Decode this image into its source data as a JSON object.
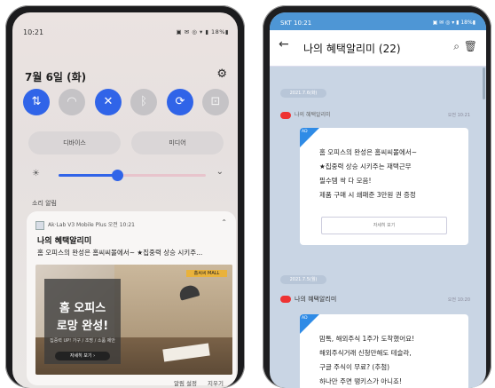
{
  "left_phone": {
    "status": {
      "time": "10:21",
      "indicators": "▣ ✉ ◎ ▾ ▮ 18%▮"
    },
    "date": "7월 6일 (화)",
    "quick_settings": [
      {
        "icon": "data-transfer-icon",
        "glyph": "⇅",
        "on": true
      },
      {
        "icon": "wifi-icon",
        "glyph": "◠",
        "on": false
      },
      {
        "icon": "sound-mute-icon",
        "glyph": "🔇",
        "on": true
      },
      {
        "icon": "bluetooth-icon",
        "glyph": "ᛒ",
        "on": false
      },
      {
        "icon": "auto-rotate-icon",
        "glyph": "⟳",
        "on": true
      },
      {
        "icon": "flashlight-icon",
        "glyph": "⊡",
        "on": false
      }
    ],
    "pills": {
      "device": "디바이스",
      "media": "미디어"
    },
    "brightness_level": 0.4,
    "section_label": "소리 알림",
    "notification": {
      "header": "Ak·Lab V3 Mobile Plus  오전 10:21",
      "title": "나의 혜택알리미",
      "body": "홈 오피스의 완성은 홈씨씨몰에서~ ★집중력 상승 시키주...",
      "image": {
        "logo": "홈씨씨 MALL",
        "headline1": "홈 오피스",
        "headline2": "로망 완성!",
        "sub": "집중력 UP! 가구 / 조명 / 소품 제안",
        "cta": "자세히 보기 ›"
      }
    },
    "footer": {
      "settings": "알림 설정",
      "clear": "지우기"
    }
  },
  "right_phone": {
    "status": {
      "carrier": "SKT 10:21",
      "indicators": "▣ ✉ ◎ ▾ ▮ 18%▮"
    },
    "appbar": {
      "title": "나의 혜택알리미 (22)"
    },
    "messages": [
      {
        "date": "2021.7.6(화)",
        "sender": "나의 혜택알리미",
        "time": "오전 10:21",
        "ribbon": "AD",
        "lines": [
          "홈 오피스의 완성은 홈씨씨몰에서~",
          "★집중력 상승 시키주는 재택근무",
          "필수템 싹 다 모음!",
          "제품 구매 시 쇄패준 3만원 권 증정"
        ],
        "button": "자세히 보기"
      },
      {
        "date": "2021.7.5(월)",
        "sender": "나의 혜택알리미",
        "time": "오전 10:20",
        "ribbon": "AD",
        "lines": [
          "맘톡, 해외주식 1주가 도착했어요!",
          "해외주식거래 신청만해도 테슬라,",
          "구글 주식이 무료? (추첨)",
          "하나만 주면 땡키스가 아니죠!"
        ]
      }
    ]
  }
}
